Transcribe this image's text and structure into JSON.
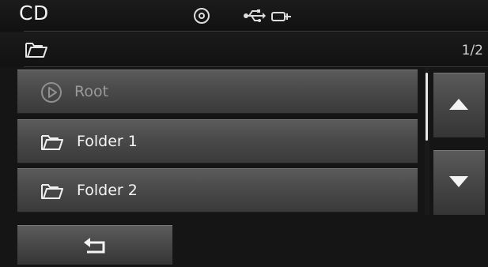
{
  "header": {
    "title": "CD",
    "icons": [
      "disc-icon",
      "usb-icon",
      "aux-icon"
    ]
  },
  "pathbar": {
    "icon": "folder-icon",
    "page_indicator": "1/2"
  },
  "list": {
    "items": [
      {
        "label": "Root",
        "icon": "play-icon",
        "active": false
      },
      {
        "label": "Folder 1",
        "icon": "folder-icon",
        "active": true
      },
      {
        "label": "Folder 2",
        "icon": "folder-icon",
        "active": true
      }
    ]
  },
  "scroll": {
    "up": "up-arrow-icon",
    "down": "down-arrow-icon"
  },
  "footer": {
    "back": "back-arrow-icon"
  }
}
